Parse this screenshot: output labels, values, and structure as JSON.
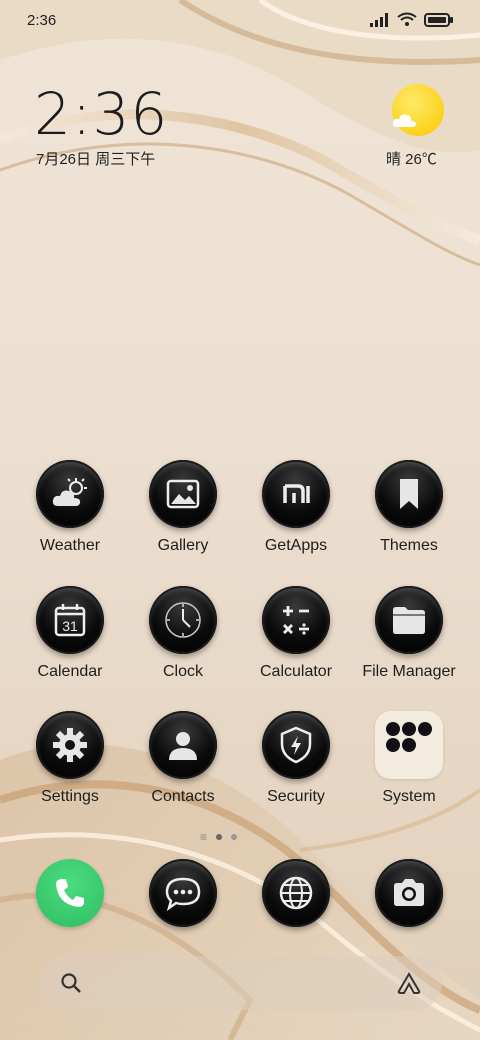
{
  "status_bar": {
    "time": "2:36"
  },
  "lock_clock": {
    "time": "2:36",
    "date": "7月26日 周三下午"
  },
  "weather": {
    "text": "晴 26℃"
  },
  "apps": [
    {
      "label": "Weather",
      "icon": "weather-icon"
    },
    {
      "label": "Gallery",
      "icon": "gallery-icon"
    },
    {
      "label": "GetApps",
      "icon": "getapps-icon"
    },
    {
      "label": "Themes",
      "icon": "themes-icon"
    },
    {
      "label": "Calendar",
      "icon": "calendar-icon",
      "badge": "31"
    },
    {
      "label": "Clock",
      "icon": "clock-icon"
    },
    {
      "label": "Calculator",
      "icon": "calculator-icon"
    },
    {
      "label": "File Manager",
      "icon": "file-manager-icon"
    },
    {
      "label": "Settings",
      "icon": "settings-icon"
    },
    {
      "label": "Contacts",
      "icon": "contacts-icon"
    },
    {
      "label": "Security",
      "icon": "security-icon"
    },
    {
      "label": "System",
      "icon": "folder-icon"
    }
  ],
  "dock": [
    {
      "icon": "phone-icon"
    },
    {
      "icon": "messages-icon"
    },
    {
      "icon": "browser-icon"
    },
    {
      "icon": "camera-icon"
    }
  ],
  "colors": {
    "phone_green": "#35c76a",
    "sun_yellow": "#fcd21c"
  }
}
